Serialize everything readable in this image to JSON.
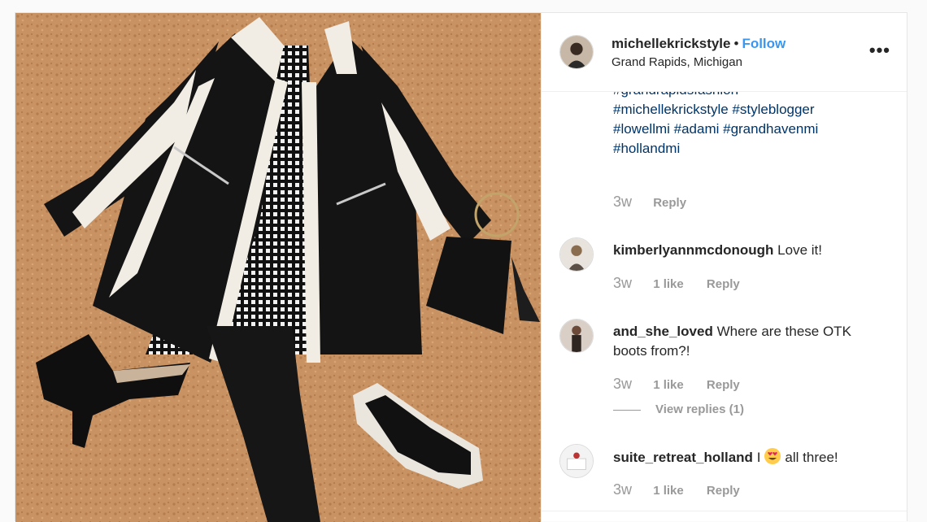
{
  "header": {
    "username": "michellekrickstyle",
    "separator": "•",
    "follow_label": "Follow",
    "location": "Grand Rapids, Michigan",
    "more_label": "•••"
  },
  "caption": {
    "lines": [
      "#grandrapidsfashion",
      "#michellekrickstyle #styleblogger",
      "#lowellmi #adami #grandhavenmi",
      "#hollandmi"
    ],
    "time": "3w",
    "reply_label": "Reply"
  },
  "comments": [
    {
      "username": "kimberlyannmcdonough",
      "text": "Love it!",
      "time": "3w",
      "likes": "1 like",
      "reply_label": "Reply"
    },
    {
      "username": "and_she_loved",
      "text": "Where are these OTK boots from?!",
      "time": "3w",
      "likes": "1 like",
      "reply_label": "Reply",
      "view_replies": "View replies (1)"
    },
    {
      "username": "suite_retreat_holland",
      "text_before": "I",
      "emoji": "heart-eyes-emoji",
      "text_after": "all three!",
      "time": "3w",
      "likes": "1 like",
      "reply_label": "Reply"
    }
  ],
  "colors": {
    "link": "#3897f0",
    "hashtag": "#003569",
    "muted": "#999999"
  }
}
